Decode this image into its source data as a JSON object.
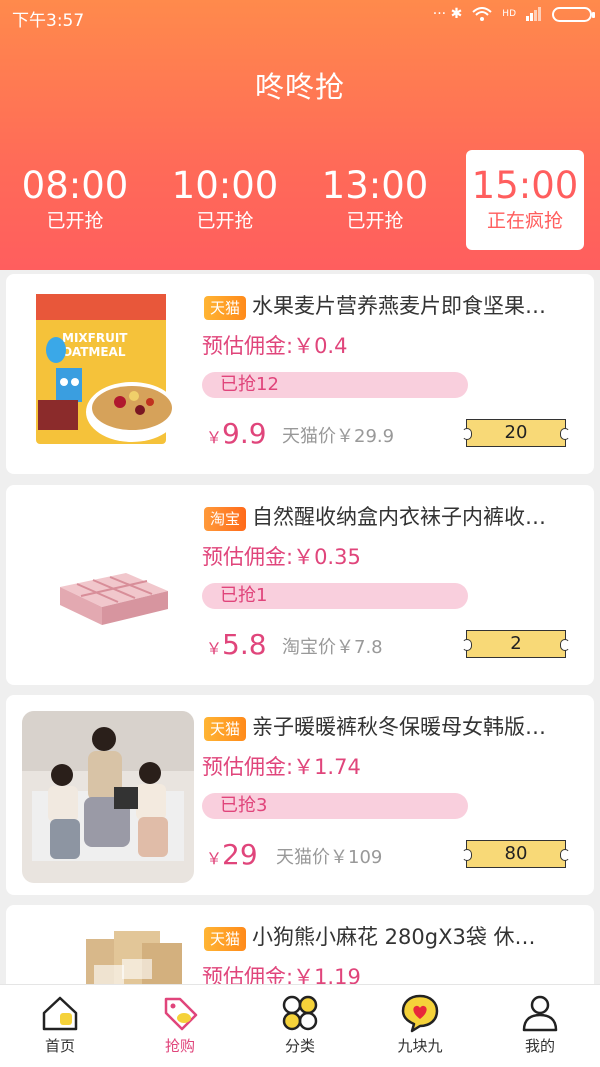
{
  "status_bar": {
    "time": "下午3:57",
    "icons": "··· ✱",
    "network": "HD"
  },
  "title": "咚咚抢",
  "time_slots": [
    {
      "time": "08:00",
      "state": "已开抢"
    },
    {
      "time": "10:00",
      "state": "已开抢"
    },
    {
      "time": "13:00",
      "state": "已开抢"
    },
    {
      "time": "15:00",
      "state": "正在疯抢",
      "active": true
    }
  ],
  "commission_prefix": "预估佣金:",
  "products": [
    {
      "platform": "天猫",
      "title": "水果麦片营养燕麦片即食坚果…",
      "commission": "预估佣金:￥0.4",
      "grabbed": "已抢12",
      "grabbed_fraction": 0.0,
      "price": "9.9",
      "original_price": "天猫价￥29.9",
      "coupon": "20",
      "thumb_icon": "oatmeal-package"
    },
    {
      "platform": "淘宝",
      "title": "自然醒收纳盒内衣袜子内裤收…",
      "commission": "预估佣金:￥0.35",
      "grabbed": "已抢1",
      "grabbed_fraction": 0.0,
      "price": "5.8",
      "original_price": "淘宝价￥7.8",
      "coupon": "2",
      "thumb_icon": "storage-box"
    },
    {
      "platform": "天猫",
      "title": "亲子暖暖裤秋冬保暖母女韩版…",
      "commission": "预估佣金:￥1.74",
      "grabbed": "已抢3",
      "grabbed_fraction": 0.0,
      "price": "29",
      "original_price": "天猫价￥109",
      "coupon": "80",
      "thumb_icon": "family-photo"
    },
    {
      "platform": "天猫",
      "title": "小狗熊小麻花 280gX3袋 休…",
      "commission": "预估佣金:￥1.19",
      "thumb_icon": "snack-bags"
    }
  ],
  "currency_symbol": "￥",
  "tabs": [
    {
      "label": "首页",
      "icon": "home-icon"
    },
    {
      "label": "抢购",
      "icon": "tag-icon",
      "active": true
    },
    {
      "label": "分类",
      "icon": "category-icon"
    },
    {
      "label": "九块九",
      "icon": "heart-bubble-icon"
    },
    {
      "label": "我的",
      "icon": "user-icon"
    }
  ],
  "colors": {
    "accent": "#e0457b",
    "header_top": "#ff8a4c",
    "header_bottom": "#ff5e5e",
    "coupon": "#f8d977"
  }
}
